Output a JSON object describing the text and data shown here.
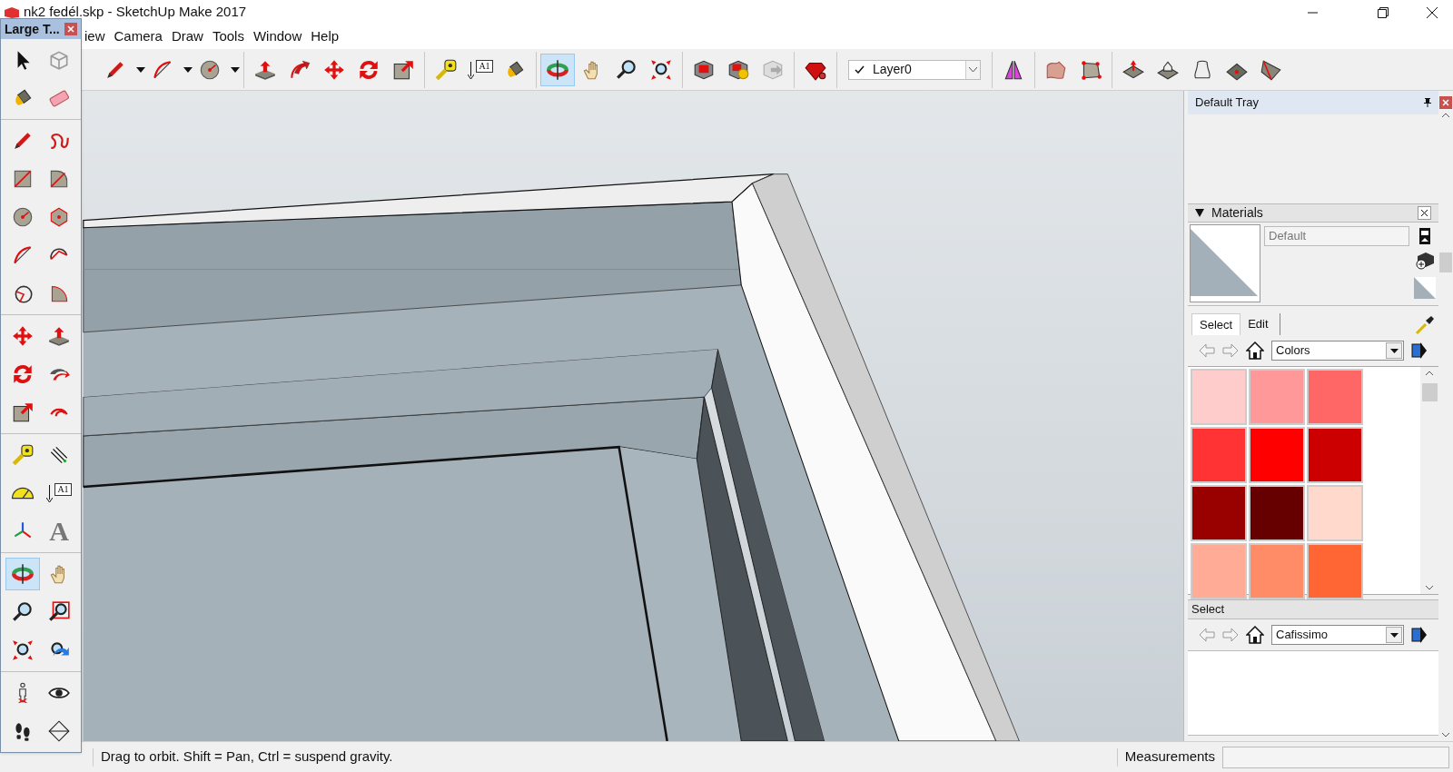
{
  "window": {
    "title": "nk2 fedél.skp - SketchUp Make 2017"
  },
  "menu": [
    "iew",
    "Camera",
    "Draw",
    "Tools",
    "Window",
    "Help"
  ],
  "toolbar": {
    "buttons": [
      {
        "selected": false
      },
      {
        "selected": false
      },
      {
        "selected": false
      },
      {
        "selected": false
      },
      {
        "selected": false
      },
      {
        "selected": false
      },
      {
        "selected": false
      },
      {
        "selected": false
      },
      {
        "selected": false
      },
      {
        "selected": false
      },
      {
        "selected": false
      },
      {
        "selected": true
      },
      {
        "selected": false
      },
      {
        "selected": false
      },
      {
        "selected": false
      },
      {
        "selected": false
      },
      {
        "selected": false
      },
      {
        "selected": false
      },
      {
        "selected": false
      },
      {
        "selected": false
      },
      {
        "selected": false
      },
      {
        "selected": false
      },
      {
        "selected": false
      },
      {
        "selected": false
      },
      {
        "selected": false
      },
      {
        "selected": false
      },
      {
        "selected": false
      }
    ],
    "text_tool_label": "A1",
    "layer": {
      "checked": true,
      "value": "Layer0"
    }
  },
  "palette": {
    "title": "Large T...",
    "text_tool_label": "A1",
    "three_d_text_label": "A",
    "buttons": [
      {
        "selected": false
      },
      {
        "selected": false
      },
      {
        "selected": false
      },
      {
        "selected": false
      },
      {
        "selected": false
      },
      {
        "selected": false
      },
      {
        "selected": false
      },
      {
        "selected": false
      },
      {
        "selected": false
      },
      {
        "selected": false
      },
      {
        "selected": false
      },
      {
        "selected": false
      },
      {
        "selected": false
      },
      {
        "selected": false
      },
      {
        "selected": false
      },
      {
        "selected": false
      },
      {
        "selected": false
      },
      {
        "selected": false
      },
      {
        "selected": false
      },
      {
        "selected": false
      },
      {
        "selected": false
      },
      {
        "selected": false
      },
      {
        "selected": false
      },
      {
        "selected": false
      },
      {
        "selected": false
      },
      {
        "selected": false
      },
      {
        "selected": true
      },
      {
        "selected": false
      },
      {
        "selected": false
      },
      {
        "selected": false
      },
      {
        "selected": false
      },
      {
        "selected": false
      },
      {
        "selected": false
      },
      {
        "selected": false
      },
      {
        "selected": false
      },
      {
        "selected": false
      }
    ]
  },
  "tray": {
    "title": "Default Tray",
    "materials": {
      "title": "Materials",
      "expanded": true,
      "name_field": {
        "value": "Default"
      },
      "tabs": [
        {
          "label": "Select",
          "selected": true
        },
        {
          "label": "Edit",
          "selected": false
        }
      ],
      "library": {
        "value": "Colors"
      },
      "swatches": [
        {
          "color": "#ffcccc"
        },
        {
          "color": "#ff9999"
        },
        {
          "color": "#ff6666"
        },
        {
          "color": "#ff3333"
        },
        {
          "color": "#ff0000"
        },
        {
          "color": "#cc0000"
        },
        {
          "color": "#990000"
        },
        {
          "color": "#660000"
        },
        {
          "color": "#ffd9cc"
        },
        {
          "color": "#ffab96"
        },
        {
          "color": "#ff8c66"
        },
        {
          "color": "#ff6633"
        }
      ],
      "secondary": {
        "title": "Select",
        "library": {
          "value": "Cafissimo"
        }
      }
    }
  },
  "status_bar": {
    "hint": "Drag to orbit. Shift = Pan, Ctrl = suspend gravity.",
    "measurements_label": "Measurements"
  }
}
